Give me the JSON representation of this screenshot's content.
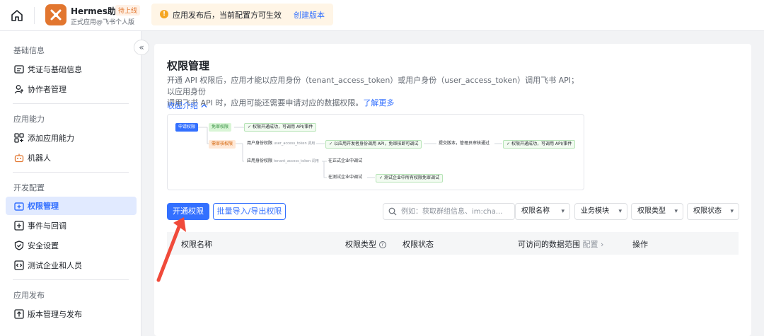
{
  "app": {
    "name": "Hermes助手",
    "status": "待上线",
    "subtitle": "正式应用@飞书个人版"
  },
  "notice": {
    "text": "应用发布后，当前配置方可生效",
    "link": "创建版本"
  },
  "sidebar": {
    "sections": [
      {
        "title": "基础信息",
        "items": [
          "凭证与基础信息",
          "协作者管理"
        ]
      },
      {
        "title": "应用能力",
        "items": [
          "添加应用能力",
          "机器人"
        ]
      },
      {
        "title": "开发配置",
        "items": [
          "权限管理",
          "事件与回调",
          "安全设置",
          "测试企业和人员"
        ]
      },
      {
        "title": "应用发布",
        "items": [
          "版本管理与发布"
        ]
      }
    ],
    "active_item": "权限管理"
  },
  "main": {
    "title": "权限管理",
    "desc_line1": "开通 API 权限后，应用才能以应用身份（tenant_access_token）或用户身份（user_access_token）调用飞书 API；以应用身份",
    "desc_line2": "调用飞书 API 时，应用可能还需要申请对应的数据权限。",
    "learn_more": "了解更多",
    "collapse_intro": "收起介绍",
    "flow": {
      "apply": "申请权限",
      "free_review": "免审权限",
      "free_result": "权限开通成功，可调用 API/事件",
      "need_review": "需审核权限",
      "user_identity": "用户身份权限",
      "user_identity_token": "user_access_token 调用",
      "dev_debug": "以应用开发者身份调用 API，免审核即可调试",
      "submit": "提交版本，管理员审核通过",
      "final_result": "权限开通成功，可调用 API/事件",
      "app_identity": "应用身份权限",
      "app_identity_token": "tenant_access_token 调用",
      "prod_debug": "在正式企业中调试",
      "test_debug": "在测试企业中调试",
      "test_result": "测试企业中所有权限免审调试"
    },
    "buttons": {
      "enable": "开通权限",
      "batch": "批量导入/导出权限"
    },
    "search": {
      "placeholder": "例如：获取群组信息、im:cha..."
    },
    "filters": [
      "权限名称",
      "业务模块",
      "权限类型",
      "权限状态"
    ],
    "table_headers": {
      "name": "权限名称",
      "type": "权限类型",
      "status": "权限状态",
      "scope": "可访问的数据范围",
      "config": "配置",
      "action": "操作"
    }
  }
}
